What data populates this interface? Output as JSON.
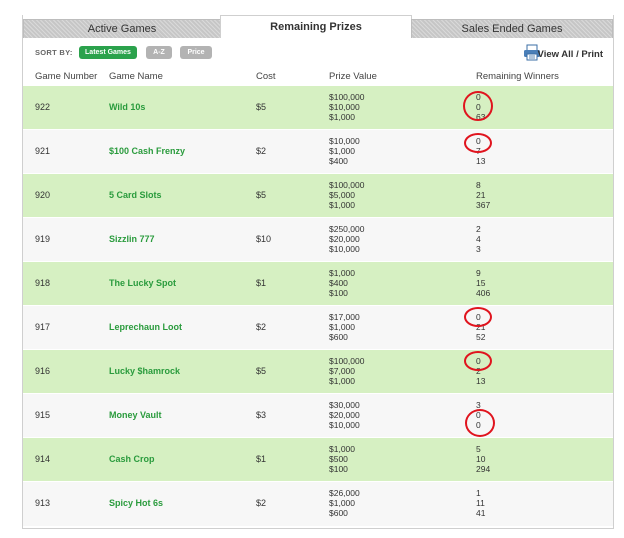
{
  "tabs": [
    "Active Games",
    "Remaining Prizes",
    "Sales Ended Games"
  ],
  "sort": {
    "label": "SORT BY:",
    "options": [
      "Latest Games",
      "A-Z",
      "Price"
    ]
  },
  "view_all": "View All / Print",
  "columns": [
    "Game Number",
    "Game Name",
    "Cost",
    "Prize Value",
    "Remaining Winners"
  ],
  "rows": [
    {
      "num": "922",
      "name": "Wild 10s",
      "cost": "$5",
      "prizes": [
        "$100,000",
        "$10,000",
        "$1,000"
      ],
      "winners": [
        "0",
        "0",
        "63"
      ]
    },
    {
      "num": "921",
      "name": "$100 Cash Frenzy",
      "cost": "$2",
      "prizes": [
        "$10,000",
        "$1,000",
        "$400"
      ],
      "winners": [
        "0",
        "7",
        "13"
      ]
    },
    {
      "num": "920",
      "name": "5 Card Slots",
      "cost": "$5",
      "prizes": [
        "$100,000",
        "$5,000",
        "$1,000"
      ],
      "winners": [
        "8",
        "21",
        "367"
      ]
    },
    {
      "num": "919",
      "name": "Sizzlin 777",
      "cost": "$10",
      "prizes": [
        "$250,000",
        "$20,000",
        "$10,000"
      ],
      "winners": [
        "2",
        "4",
        "3"
      ]
    },
    {
      "num": "918",
      "name": "The Lucky Spot",
      "cost": "$1",
      "prizes": [
        "$1,000",
        "$400",
        "$100"
      ],
      "winners": [
        "9",
        "15",
        "406"
      ]
    },
    {
      "num": "917",
      "name": "Leprechaun Loot",
      "cost": "$2",
      "prizes": [
        "$17,000",
        "$1,000",
        "$600"
      ],
      "winners": [
        "0",
        "21",
        "52"
      ]
    },
    {
      "num": "916",
      "name": "Lucky $hamrock",
      "cost": "$5",
      "prizes": [
        "$100,000",
        "$7,000",
        "$1,000"
      ],
      "winners": [
        "0",
        "2",
        "13"
      ]
    },
    {
      "num": "915",
      "name": "Money Vault",
      "cost": "$3",
      "prizes": [
        "$30,000",
        "$20,000",
        "$10,000"
      ],
      "winners": [
        "3",
        "0",
        "0"
      ]
    },
    {
      "num": "914",
      "name": "Cash Crop",
      "cost": "$1",
      "prizes": [
        "$1,000",
        "$500",
        "$100"
      ],
      "winners": [
        "5",
        "10",
        "294"
      ]
    },
    {
      "num": "913",
      "name": "Spicy Hot 6s",
      "cost": "$2",
      "prizes": [
        "$26,000",
        "$1,000",
        "$600"
      ],
      "winners": [
        "1",
        "11",
        "41"
      ]
    }
  ],
  "colors": {
    "highlight_circle": "#e0141e",
    "row_green": "#d6f0c2",
    "game_name": "#2a9b3d",
    "sort_active": "#2ba24c"
  }
}
